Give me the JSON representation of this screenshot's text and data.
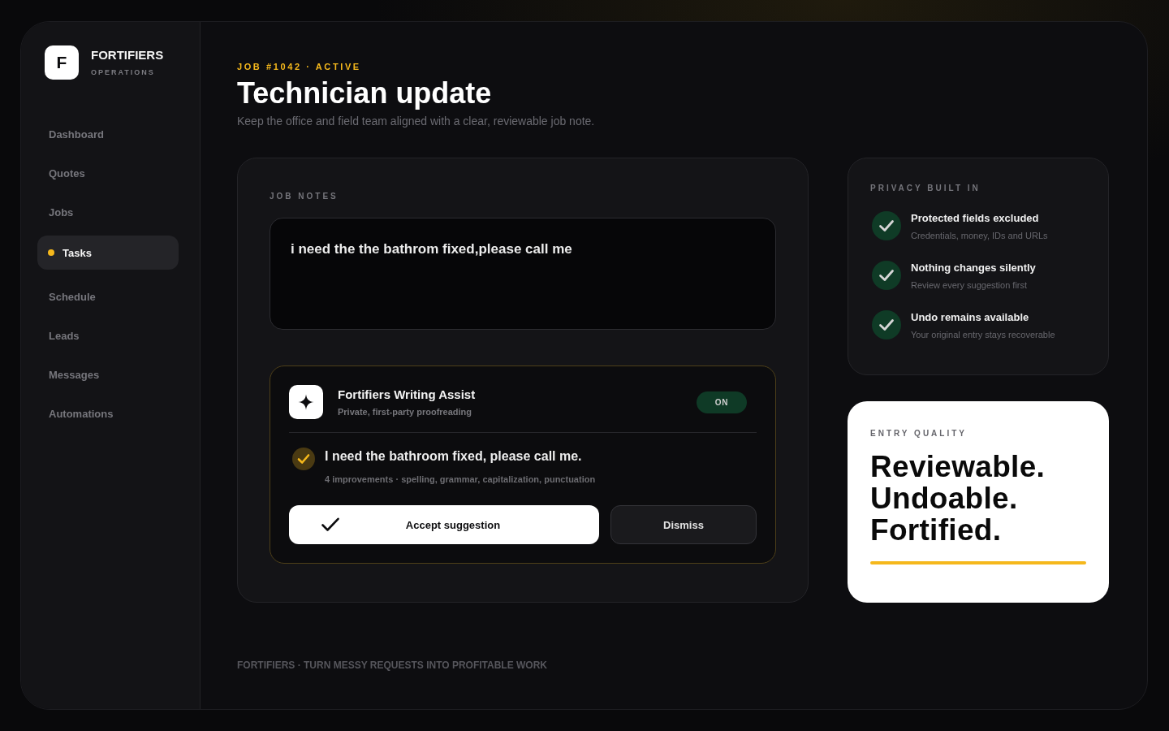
{
  "sidebar": {
    "brand": {
      "logo": "F",
      "name": "FORTIFIERS",
      "subtitle": "OPERATIONS"
    },
    "items": [
      {
        "label": "Dashboard",
        "selected": false
      },
      {
        "label": "Quotes",
        "selected": false
      },
      {
        "label": "Jobs",
        "selected": false
      },
      {
        "label": "Tasks",
        "selected": true
      },
      {
        "label": "Schedule",
        "selected": false
      },
      {
        "label": "Leads",
        "selected": false
      },
      {
        "label": "Messages",
        "selected": false
      },
      {
        "label": "Automations",
        "selected": false
      }
    ]
  },
  "header": {
    "eyebrow": "JOB #1042 · ACTIVE",
    "title": "Technician update",
    "subtitle": "Keep the office and field team aligned with a clear, reviewable job note."
  },
  "job_notes": {
    "label": "JOB NOTES",
    "value": "i need the the bathrom fixed,please call me",
    "assist": {
      "title": "Fortifiers Writing Assist",
      "subtitle": "Private, first-party proofreading",
      "toggle": {
        "label": "ON",
        "on": true
      },
      "suggestion": {
        "text": "I need the bathroom fixed, please call me.",
        "meta": "4 improvements · spelling, grammar, capitalization, punctuation"
      },
      "buttons": [
        {
          "label": "Accept suggestion",
          "kind": "primary"
        },
        {
          "label": "Dismiss",
          "kind": "secondary"
        }
      ]
    }
  },
  "privacy": {
    "label": "PRIVACY BUILT IN",
    "items": [
      {
        "title": "Protected fields excluded",
        "description": "Credentials, money, IDs and URLs"
      },
      {
        "title": "Nothing changes silently",
        "description": "Review every suggestion first"
      },
      {
        "title": "Undo remains available",
        "description": "Your original entry stays recoverable"
      }
    ]
  },
  "entry_quality": {
    "label": "ENTRY QUALITY",
    "lines": [
      "Reviewable.",
      "Undoable.",
      "Fortified."
    ]
  },
  "footer": "FORTIFIERS · TURN MESSY REQUESTS INTO PROFITABLE WORK"
}
